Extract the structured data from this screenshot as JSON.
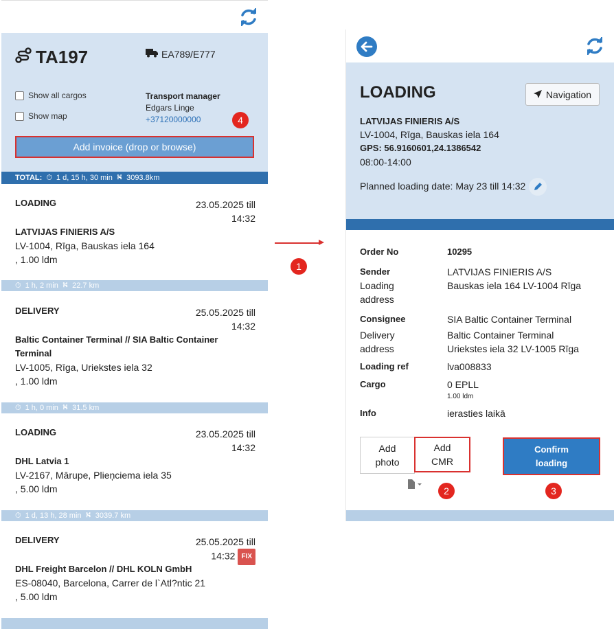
{
  "colors": {
    "accent": "#2f7cc4",
    "dark_bar": "#2f6fad",
    "light_bar": "#b7cfe6",
    "header_bg": "#d5e3f2",
    "highlight": "#d9312f",
    "badge": "#e3261f"
  },
  "left": {
    "route_id": "TA197",
    "plate": "EA789/E777",
    "show_all_cargos": "Show all cargos",
    "show_map": "Show map",
    "manager_title": "Transport manager",
    "manager_name": "Edgars Linge",
    "manager_phone": "+37120000000",
    "add_invoice": "Add invoice (drop or browse)",
    "total": {
      "label": "TOTAL:",
      "time": "1 d, 15 h, 30 min",
      "distance": "3093.8km"
    },
    "stops": [
      {
        "type": "LOADING",
        "date1": "23.05.2025 till",
        "date2": "14:32",
        "company": "LATVIJAS FINIERIS A/S",
        "address": "LV-1004, Rīga, Bauskas iela 164",
        "amount": ", 1.00 ldm"
      },
      {
        "type": "DELIVERY",
        "date1": "25.05.2025 till",
        "date2": "14:32",
        "company": "Baltic Container Terminal // SIA Baltic Container Terminal",
        "address": "LV-1005, Rīga, Uriekstes iela 32",
        "amount": ", 1.00 ldm"
      },
      {
        "type": "LOADING",
        "date1": "23.05.2025 till",
        "date2": "14:32",
        "company": "DHL Latvia 1",
        "address": "LV-2167, Mārupe, Plieņciema iela 35",
        "amount": ", 5.00 ldm"
      },
      {
        "type": "DELIVERY",
        "date1": "25.05.2025 till",
        "date2": "14:32",
        "badge": "FIX",
        "company": "DHL Freight Barcelon // DHL KOLN GmbH",
        "address": "ES-08040, Barcelona, Carrer de l`Atl?ntic 21",
        "amount": ", 5.00 ldm"
      }
    ],
    "legs": [
      {
        "time": "1 h, 2 min",
        "distance": "22.7 km"
      },
      {
        "time": "1 h, 0 min",
        "distance": "31.5 km"
      },
      {
        "time": "1 d, 13 h, 28 min",
        "distance": "3039.7 km"
      }
    ]
  },
  "right": {
    "title": "LOADING",
    "navigation": "Navigation",
    "company": "LATVIJAS FINIERIS A/S",
    "address": "LV-1004, Rīga, Bauskas iela 164",
    "gps": "GPS: 56.9160601,24.1386542",
    "hours": "08:00-14:00",
    "planned": "Planned loading date: May 23 till 14:32",
    "details": {
      "order_label": "Order No",
      "order_value": "10295",
      "sender_label": "Sender",
      "sender_value": "LATVIJAS FINIERIS A/S",
      "loading_addr_label1": "Loading",
      "loading_addr_label2": "address",
      "loading_addr_value": "Bauskas iela 164 LV-1004 Rīga",
      "consignee_label": "Consignee",
      "consignee_value": "SIA Baltic Container Terminal",
      "delivery_label1": "Delivery",
      "delivery_label2": "address",
      "delivery_value1": "Baltic Container Terminal",
      "delivery_value2": "Uriekstes iela 32 LV-1005 Rīga",
      "loading_ref_label": "Loading ref",
      "loading_ref_value": "lva008833",
      "cargo_label": "Cargo",
      "cargo_value": "0 EPLL",
      "cargo_sub": "1.00 ldm",
      "info_label": "Info",
      "info_value": "ierasties laikā"
    },
    "add_photo1": "Add",
    "add_photo2": "photo",
    "add_cmr1": "Add",
    "add_cmr2": "CMR",
    "confirm1": "Confirm",
    "confirm2": "loading"
  },
  "steps": {
    "s1": "1",
    "s2": "2",
    "s3": "3",
    "s4": "4"
  }
}
